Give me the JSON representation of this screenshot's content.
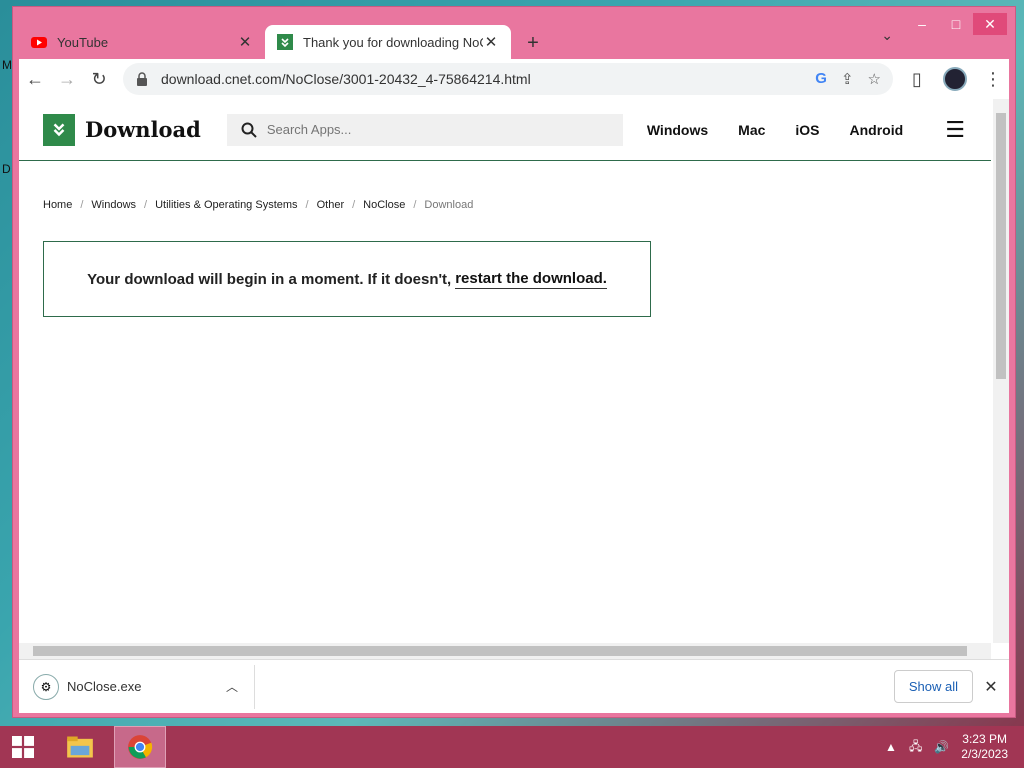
{
  "desktop": {
    "left_labels": [
      "M",
      "D"
    ]
  },
  "window": {
    "controls": {
      "minimize": "–",
      "maximize": "□",
      "close": "✕"
    }
  },
  "tabs": [
    {
      "title": "YouTube",
      "icon": "youtube-icon",
      "close": "✕",
      "active": false
    },
    {
      "title": "Thank you for downloading NoClose",
      "icon": "download-favicon",
      "close": "✕",
      "active": true
    }
  ],
  "new_tab_label": "+",
  "tab_dropdown": "⌄",
  "toolbar": {
    "back": "←",
    "forward": "→",
    "reload": "↻",
    "url": "download.cnet.com/NoClose/3001-20432_4-75864214.html"
  },
  "site": {
    "logo_text": "Download",
    "search_placeholder": "Search Apps...",
    "nav": [
      "Windows",
      "Mac",
      "iOS",
      "Android"
    ],
    "breadcrumb": [
      "Home",
      "Windows",
      "Utilities & Operating Systems",
      "Other",
      "NoClose",
      "Download"
    ],
    "message": "Your download will begin in a moment. If it doesn't,",
    "message_link": "restart the download."
  },
  "download_bar": {
    "file_name": "NoClose.exe",
    "show_all": "Show all",
    "close": "✕"
  },
  "taskbar": {
    "time": "3:23 PM",
    "date": "2/3/2023"
  },
  "colors": {
    "window_frame": "#e9769f",
    "brand_green": "#2f8a4a",
    "taskbar": "#a13654"
  }
}
